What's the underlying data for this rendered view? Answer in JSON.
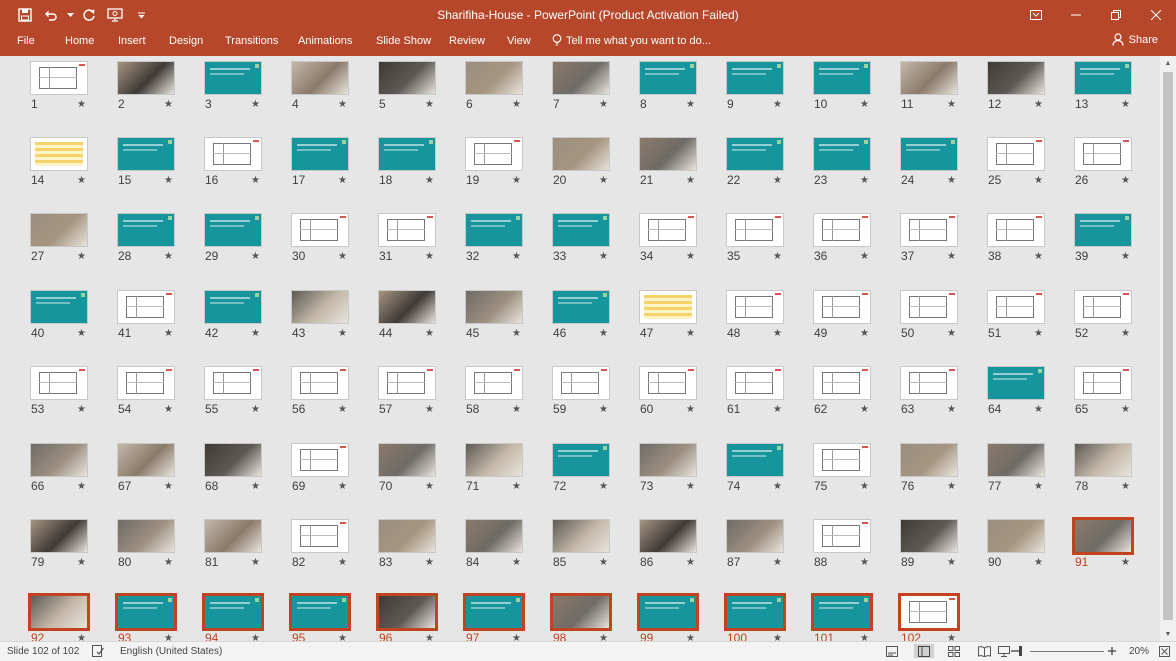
{
  "window": {
    "title": "Sharifiha-House - PowerPoint (Product Activation Failed)"
  },
  "ribbon": {
    "tabs": [
      "File",
      "Home",
      "Insert",
      "Design",
      "Transitions",
      "Animations",
      "Slide Show",
      "Review",
      "View"
    ],
    "tell_me": "Tell me what you want to do...",
    "share": "Share"
  },
  "sorter": {
    "slide_count": 102,
    "selected": [
      91,
      92,
      93,
      94,
      95,
      96,
      97,
      98,
      99,
      100,
      101,
      102
    ],
    "star_glyph": "★",
    "colors": {
      "teal": "#17959d",
      "selected_border": "#c1431f"
    }
  },
  "status": {
    "slide_indicator": "Slide 102 of 102",
    "language": "English (United States)",
    "zoom": "20%"
  }
}
